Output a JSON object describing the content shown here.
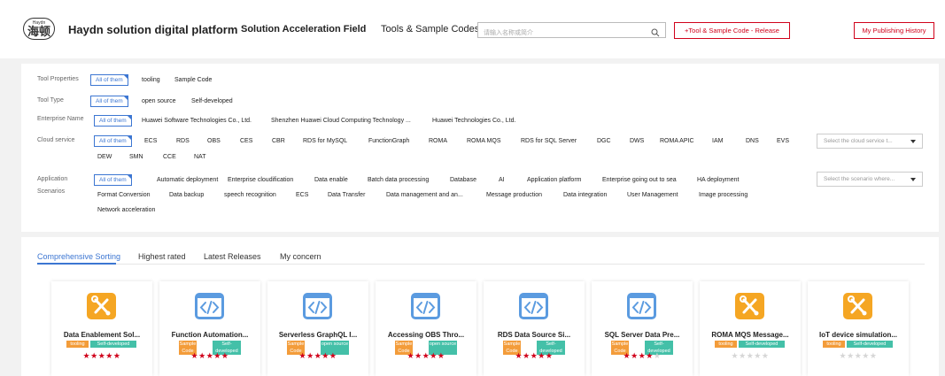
{
  "header": {
    "logo_small": "Haydn",
    "logo_glyph": "海顿",
    "brand": "Haydn solution digital platform",
    "nav": [
      "Solution Acceleration Field",
      "Tools & Sample Codes"
    ],
    "search_placeholder": "请输入名称或简介",
    "release_button": "+Tool & Sample Code - Release",
    "history_button": "My Publishing History",
    "accent": "#d0021b"
  },
  "filters": {
    "all_label": "All of them",
    "tool_properties": {
      "label": "Tool Properties",
      "options": [
        "tooling",
        "Sample Code"
      ]
    },
    "tool_type": {
      "label": "Tool Type",
      "options": [
        "open source",
        "Self-developed"
      ]
    },
    "enterprise_name": {
      "label": "Enterprise Name",
      "options": [
        "Huawei Software Technologies Co., Ltd.",
        "Shenzhen Huawei Cloud Computing Technology ...",
        "Huawei Technologies Co., Ltd."
      ]
    },
    "cloud_service": {
      "label": "Cloud service",
      "options": [
        "ECS",
        "RDS",
        "OBS",
        "CES",
        "CBR",
        "RDS for MySQL",
        "FunctionGraph",
        "ROMA",
        "ROMA MQS",
        "RDS for SQL Server",
        "DGC",
        "DWS",
        "ROMA APIC",
        "IAM",
        "DNS",
        "EVS",
        "DEW",
        "SMN",
        "CCE",
        "NAT"
      ],
      "select_placeholder": "Select the cloud service t..."
    },
    "scenarios": {
      "label_line1": "Application",
      "label_line2": "Scenarios",
      "options": [
        "Automatic deployment",
        "Enterprise cloudification",
        "Data enable",
        "Batch data processing",
        "Database",
        "AI",
        "Application platform",
        "Enterprise going out to sea",
        "HA deployment",
        "Format Conversion",
        "Data backup",
        "speech recognition",
        "ECS",
        "Data Transfer",
        "Data management and an...",
        "Message production",
        "Data integration",
        "User Management",
        "Image processing",
        "Network acceleration"
      ],
      "select_placeholder": "Select the scenario where..."
    }
  },
  "sorting": {
    "tabs": [
      "Comprehensive Sorting",
      "Highest rated",
      "Latest Releases",
      "My concern"
    ],
    "active": "Comprehensive Sorting"
  },
  "cards": [
    {
      "title": "Data Enablement Sol...",
      "icon": "tools-icon",
      "tags": [
        "tooling",
        "Self-developed"
      ],
      "rating": 5
    },
    {
      "title": "Function Automation...",
      "icon": "code-icon",
      "tags": [
        "Sample Code",
        "Self-developed"
      ],
      "rating": 5
    },
    {
      "title": "Serverless GraphQL I...",
      "icon": "code-icon",
      "tags": [
        "Sample Code",
        "open source"
      ],
      "rating": 5
    },
    {
      "title": "Accessing OBS Thro...",
      "icon": "code-icon",
      "tags": [
        "Sample Code",
        "open source"
      ],
      "rating": 5
    },
    {
      "title": "RDS Data Source Si...",
      "icon": "code-icon",
      "tags": [
        "Sample Code",
        "Self-developed"
      ],
      "rating": 5
    },
    {
      "title": "SQL Server Data Pre...",
      "icon": "code-icon",
      "tags": [
        "Sample Code",
        "Self-developed"
      ],
      "rating": 4
    },
    {
      "title": "ROMA MQS Message...",
      "icon": "tools-icon",
      "tags": [
        "tooling",
        "Self-developed"
      ],
      "rating": 0
    },
    {
      "title": "IoT device simulation...",
      "icon": "tools-icon",
      "tags": [
        "tooling",
        "Self-developed"
      ],
      "rating": 0
    }
  ]
}
